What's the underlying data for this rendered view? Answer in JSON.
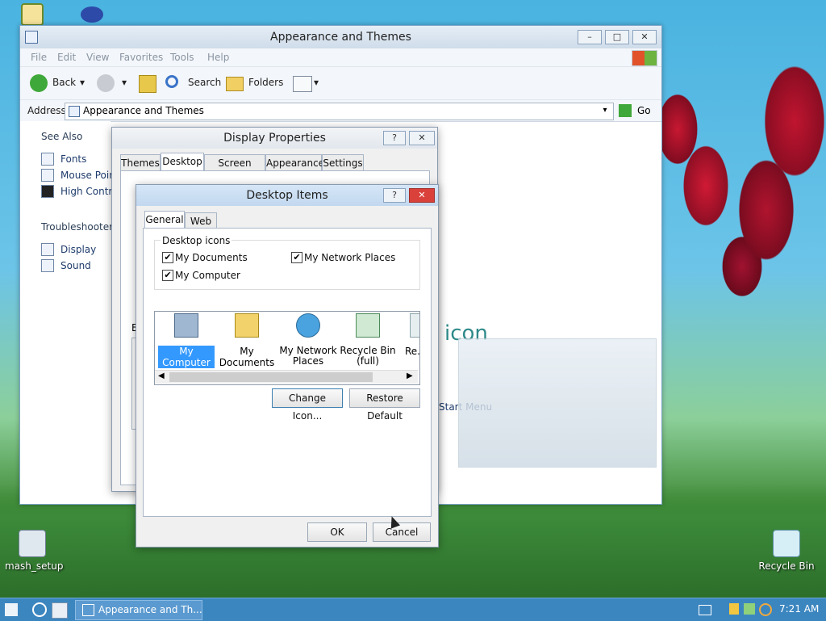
{
  "desktop": {
    "icons": [
      {
        "label": "mash_setup"
      },
      {
        "label": "Recycle Bin"
      }
    ]
  },
  "explorer": {
    "title": "Appearance and Themes",
    "menu": [
      "File",
      "Edit",
      "View",
      "Favorites",
      "Tools",
      "Help"
    ],
    "toolbar": {
      "back": "Back",
      "search": "Search",
      "folders": "Folders"
    },
    "address": {
      "label": "Address",
      "value": "Appearance and Themes",
      "go": "Go"
    },
    "sidebar": {
      "see_also": "See Also",
      "see_also_items": [
        "Fonts",
        "Mouse Poin",
        "High Contra"
      ],
      "troubleshooters": "Troubleshooters",
      "troubleshooter_items": [
        "Display",
        "Sound"
      ]
    },
    "content": {
      "icon_text": "icon",
      "start_menu": "Start Menu"
    }
  },
  "display_properties": {
    "title": "Display Properties",
    "help": "?",
    "close": "✕",
    "tabs": [
      "Themes",
      "Desktop",
      "Screen Saver",
      "Appearance",
      "Settings"
    ],
    "active_tab": "Desktop",
    "partial_label": "B"
  },
  "desktop_items": {
    "title": "Desktop Items",
    "help": "?",
    "close": "✕",
    "tabs": [
      "General",
      "Web"
    ],
    "active_tab": "General",
    "group_label": "Desktop icons",
    "checkboxes": [
      {
        "label": "My Documents",
        "checked": true
      },
      {
        "label": "My Network Places",
        "checked": true
      },
      {
        "label": "My Computer",
        "checked": true
      }
    ],
    "icons": [
      {
        "label": "My Computer",
        "selected": true
      },
      {
        "label": "My Documents"
      },
      {
        "label": "My Network Places"
      },
      {
        "label": "Recycle Bin (full)"
      },
      {
        "label": "Re..."
      }
    ],
    "change_icon": "Change Icon...",
    "restore_default": "Restore Default",
    "ok": "OK",
    "cancel": "Cancel"
  },
  "taskbar": {
    "task": "Appearance and Th...",
    "clock": "7:21 AM"
  },
  "colors": {
    "taskbar": "#3c86c0",
    "dialog_title": "#cfe3f7",
    "close_red": "#d9413a",
    "selection": "#3399ff"
  }
}
